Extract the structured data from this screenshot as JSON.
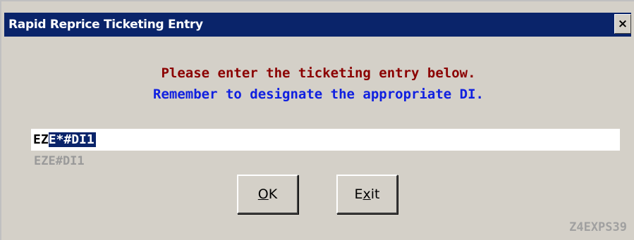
{
  "window": {
    "title": "Rapid Reprice Ticketing Entry",
    "close_label": "×"
  },
  "message": {
    "line1": "Please enter the ticketing entry below.",
    "line2": "Remember to designate the appropriate DI."
  },
  "entry": {
    "prefix": "EZ",
    "selected": "E*#DI1"
  },
  "previous_entry": "EZE#DI1",
  "buttons": {
    "ok_mnemonic": "O",
    "ok_rest": "K",
    "exit_first": "E",
    "exit_mnemonic": "x",
    "exit_rest": "it"
  },
  "screen_code": "Z4EXPS39",
  "colors": {
    "titlebar": "#0a246a",
    "message_line1": "#8b0000",
    "message_line2": "#1020e0",
    "dialog_bg": "#d4d0c8"
  }
}
